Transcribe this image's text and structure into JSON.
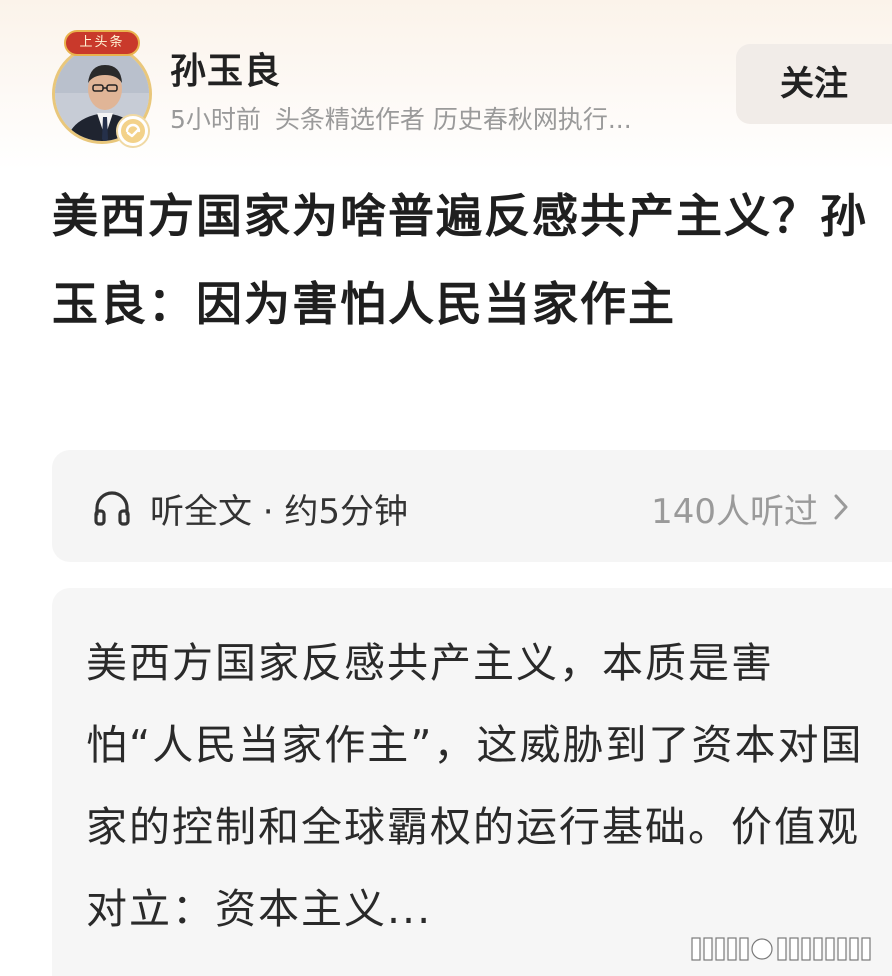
{
  "author": {
    "name": "孙玉良",
    "banner": "上头条",
    "time": "5小时前",
    "meta": "头条精选作者 历史春秋网执行..."
  },
  "follow_button": {
    "label": "关注"
  },
  "article": {
    "title": "美西方国家为啥普遍反感共产主义？孙玉良：因为害怕人民当家作主"
  },
  "listen": {
    "label": "听全文 · 约5分钟",
    "count": "140人听过"
  },
  "summary": {
    "text": "美西方国家反感共产主义，本质是害怕“人民当家作主”，这威胁到了资本对国家的控制和全球霸权的运行基础。价值观对立：资本主义..."
  },
  "colors": {
    "avatar_ring": "#e9c77b",
    "banner_red": "#c9392b",
    "verified_gold": "#d9a441",
    "meta_gray": "#9a9a9a"
  },
  "icons": [
    "headphone-icon",
    "chevron-right-icon",
    "verified-badge-icon"
  ]
}
